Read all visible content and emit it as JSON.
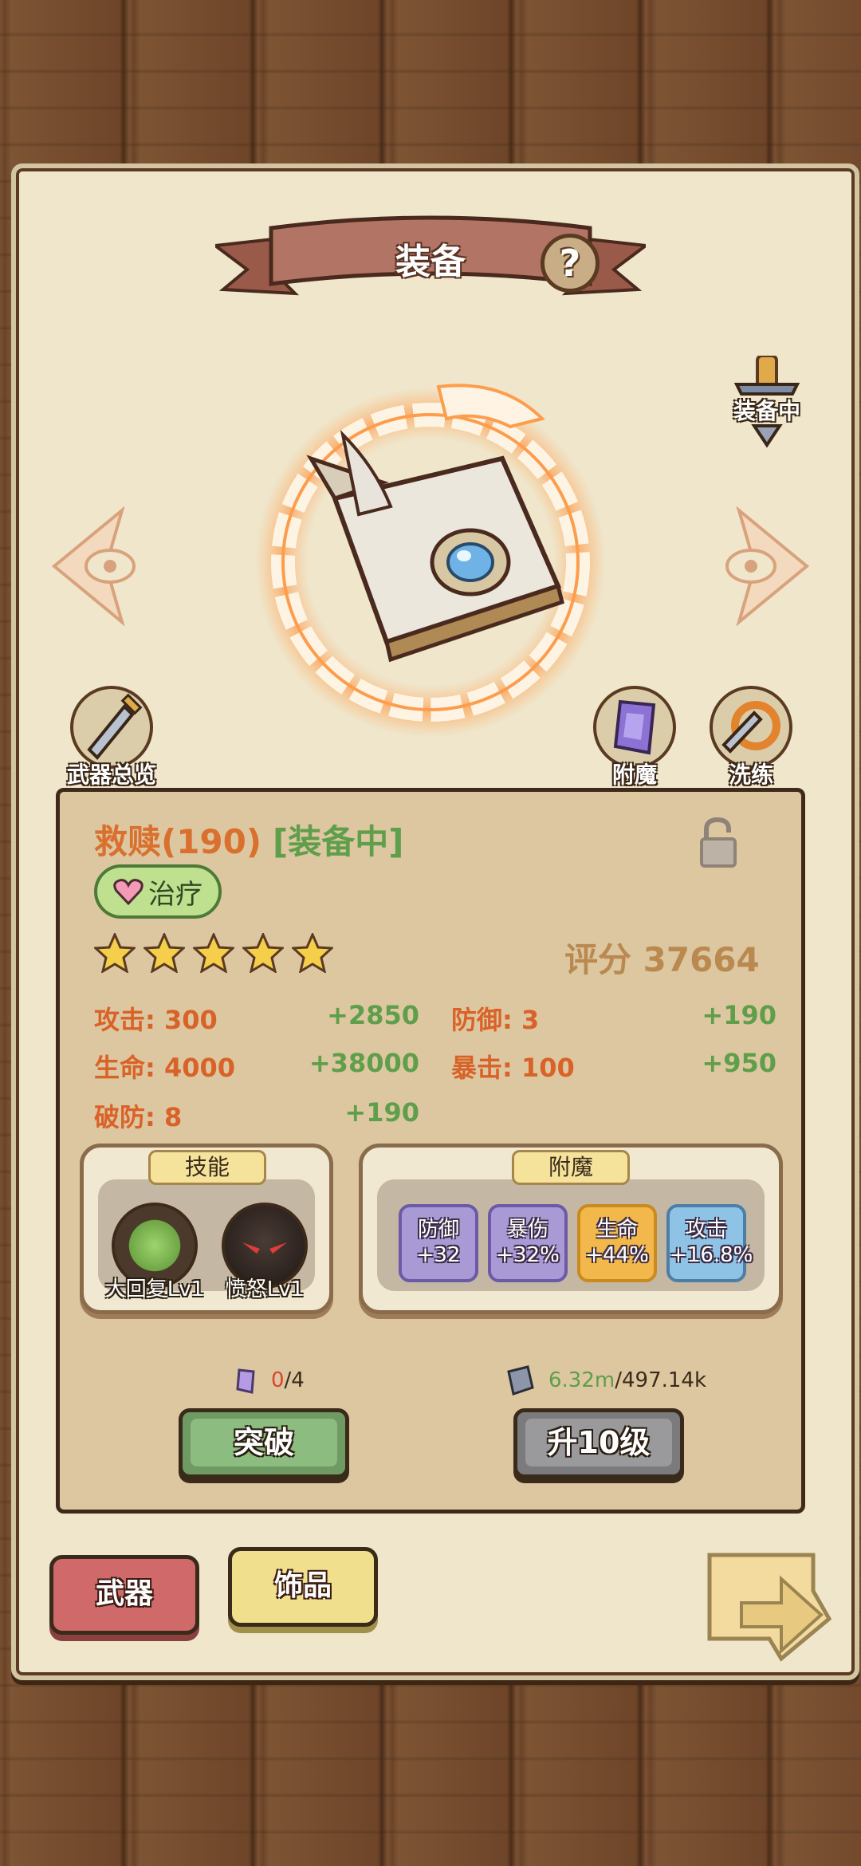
{
  "header": {
    "title": "装备",
    "help_symbol": "?"
  },
  "equip_flag": {
    "label": "装备中"
  },
  "nav": {
    "prev_icon": "chevron-left-icon",
    "next_icon": "chevron-right-icon"
  },
  "side_buttons": {
    "weapons_overview": "武器总览",
    "enchant": "附魔",
    "reforge": "洗练"
  },
  "item": {
    "name": "救赎(190)",
    "status": "[装备中]",
    "tag": "治疗",
    "stars": 5,
    "score_label": "评分 37664"
  },
  "stats": [
    {
      "key": "攻击: 300",
      "bonus": "+2850"
    },
    {
      "key": "防御: 3",
      "bonus": "+190"
    },
    {
      "key": "生命: 4000",
      "bonus": "+38000"
    },
    {
      "key": "暴击: 100",
      "bonus": "+950"
    },
    {
      "key": "破防: 8",
      "bonus": "+190"
    }
  ],
  "skills": {
    "title": "技能",
    "list": [
      {
        "name": "大回复Lv1"
      },
      {
        "name": "愤怒Lv1"
      }
    ]
  },
  "enchant": {
    "title": "附魔",
    "list": [
      {
        "name": "防御",
        "value": "+32",
        "color": "#a99ad6"
      },
      {
        "name": "暴伤",
        "value": "+32%",
        "color": "#a99ad6"
      },
      {
        "name": "生命",
        "value": "+44%",
        "color": "#f2b84b"
      },
      {
        "name": "攻击",
        "value": "+16.8%",
        "color": "#8fc3e6"
      }
    ]
  },
  "resources": {
    "stone_have": "0",
    "stone_need": "/4",
    "book_have": "6.32m",
    "book_need": "/497.14k"
  },
  "actions": {
    "breakthrough": "突破",
    "upgrade10": "升10级"
  },
  "tabs": {
    "weapon": "武器",
    "accessory": "饰品"
  },
  "colors": {
    "orange": "#d9702e",
    "green": "#5f9e4a",
    "parchment": "#efe6cc"
  }
}
